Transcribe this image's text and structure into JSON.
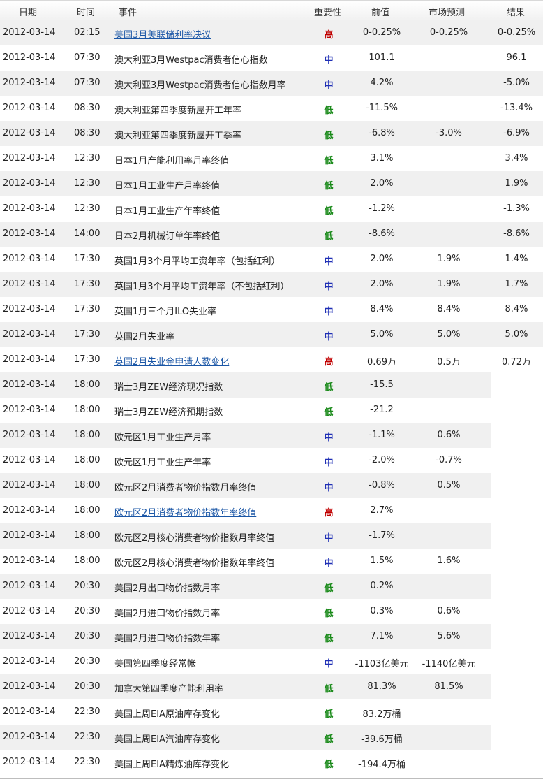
{
  "header": {
    "date": "日期",
    "time": "时间",
    "event": "事件",
    "importance": "重要性",
    "previous": "前值",
    "forecast": "市场预测",
    "actual": "结果"
  },
  "colors": {
    "high": "#c00000",
    "medium": "#1f2fb5",
    "low": "#1a8a1a",
    "link": "#1a56a6",
    "stripe": "#f0f0f0"
  },
  "rows": [
    {
      "date": "2012-03-14",
      "time": "02:15",
      "event": "美国3月美联储利率决议",
      "link": true,
      "importance": "高",
      "level": "high",
      "previous": "0-0.25%",
      "forecast": "0-0.25%",
      "actual": "0-0.25%"
    },
    {
      "date": "2012-03-14",
      "time": "07:30",
      "event": "澳大利亚3月Westpac消费者信心指数",
      "link": false,
      "importance": "中",
      "level": "medium",
      "previous": "101.1",
      "forecast": "",
      "actual": "96.1"
    },
    {
      "date": "2012-03-14",
      "time": "07:30",
      "event": "澳大利亚3月Westpac消费者信心指数月率",
      "link": false,
      "importance": "中",
      "level": "medium",
      "previous": "4.2%",
      "forecast": "",
      "actual": "-5.0%"
    },
    {
      "date": "2012-03-14",
      "time": "08:30",
      "event": "澳大利亚第四季度新屋开工年率",
      "link": false,
      "importance": "低",
      "level": "low",
      "previous": "-11.5%",
      "forecast": "",
      "actual": "-13.4%"
    },
    {
      "date": "2012-03-14",
      "time": "08:30",
      "event": "澳大利亚第四季度新屋开工季率",
      "link": false,
      "importance": "低",
      "level": "low",
      "previous": "-6.8%",
      "forecast": "-3.0%",
      "actual": "-6.9%"
    },
    {
      "date": "2012-03-14",
      "time": "12:30",
      "event": "日本1月产能利用率月率终值",
      "link": false,
      "importance": "低",
      "level": "low",
      "previous": "3.1%",
      "forecast": "",
      "actual": "3.4%"
    },
    {
      "date": "2012-03-14",
      "time": "12:30",
      "event": "日本1月工业生产月率终值",
      "link": false,
      "importance": "低",
      "level": "low",
      "previous": "2.0%",
      "forecast": "",
      "actual": "1.9%"
    },
    {
      "date": "2012-03-14",
      "time": "12:30",
      "event": "日本1月工业生产年率终值",
      "link": false,
      "importance": "低",
      "level": "low",
      "previous": "-1.2%",
      "forecast": "",
      "actual": "-1.3%"
    },
    {
      "date": "2012-03-14",
      "time": "14:00",
      "event": "日本2月机械订单年率终值",
      "link": false,
      "importance": "低",
      "level": "low",
      "previous": "-8.6%",
      "forecast": "",
      "actual": "-8.6%"
    },
    {
      "date": "2012-03-14",
      "time": "17:30",
      "event": "英国1月3个月平均工资年率（包括红利）",
      "link": false,
      "importance": "中",
      "level": "medium",
      "previous": "2.0%",
      "forecast": "1.9%",
      "actual": "1.4%"
    },
    {
      "date": "2012-03-14",
      "time": "17:30",
      "event": "英国1月3个月平均工资年率（不包括红利）",
      "link": false,
      "importance": "中",
      "level": "medium",
      "previous": "2.0%",
      "forecast": "1.9%",
      "actual": "1.7%"
    },
    {
      "date": "2012-03-14",
      "time": "17:30",
      "event": "英国1月三个月ILO失业率",
      "link": false,
      "importance": "中",
      "level": "medium",
      "previous": "8.4%",
      "forecast": "8.4%",
      "actual": "8.4%"
    },
    {
      "date": "2012-03-14",
      "time": "17:30",
      "event": "英国2月失业率",
      "link": false,
      "importance": "中",
      "level": "medium",
      "previous": "5.0%",
      "forecast": "5.0%",
      "actual": "5.0%"
    },
    {
      "date": "2012-03-14",
      "time": "17:30",
      "event": "英国2月失业金申请人数变化",
      "link": true,
      "importance": "高",
      "level": "high",
      "previous": "0.69万",
      "forecast": "0.5万",
      "actual": "0.72万"
    },
    {
      "date": "2012-03-14",
      "time": "18:00",
      "event": "瑞士3月ZEW经济现况指数",
      "link": false,
      "importance": "低",
      "level": "low",
      "previous": "-15.5",
      "forecast": "",
      "actual": ""
    },
    {
      "date": "2012-03-14",
      "time": "18:00",
      "event": "瑞士3月ZEW经济预期指数",
      "link": false,
      "importance": "低",
      "level": "low",
      "previous": "-21.2",
      "forecast": "",
      "actual": ""
    },
    {
      "date": "2012-03-14",
      "time": "18:00",
      "event": "欧元区1月工业生产月率",
      "link": false,
      "importance": "中",
      "level": "medium",
      "previous": "-1.1%",
      "forecast": "0.6%",
      "actual": ""
    },
    {
      "date": "2012-03-14",
      "time": "18:00",
      "event": "欧元区1月工业生产年率",
      "link": false,
      "importance": "中",
      "level": "medium",
      "previous": "-2.0%",
      "forecast": "-0.7%",
      "actual": ""
    },
    {
      "date": "2012-03-14",
      "time": "18:00",
      "event": "欧元区2月消费者物价指数月率终值",
      "link": false,
      "importance": "中",
      "level": "medium",
      "previous": "-0.8%",
      "forecast": "0.5%",
      "actual": ""
    },
    {
      "date": "2012-03-14",
      "time": "18:00",
      "event": "欧元区2月消费者物价指数年率终值",
      "link": true,
      "importance": "高",
      "level": "high",
      "previous": "2.7%",
      "forecast": "",
      "actual": ""
    },
    {
      "date": "2012-03-14",
      "time": "18:00",
      "event": "欧元区2月核心消费者物价指数月率终值",
      "link": false,
      "importance": "中",
      "level": "medium",
      "previous": "-1.7%",
      "forecast": "",
      "actual": ""
    },
    {
      "date": "2012-03-14",
      "time": "18:00",
      "event": "欧元区2月核心消费者物价指数年率终值",
      "link": false,
      "importance": "中",
      "level": "medium",
      "previous": "1.5%",
      "forecast": "1.6%",
      "actual": ""
    },
    {
      "date": "2012-03-14",
      "time": "20:30",
      "event": "美国2月出口物价指数月率",
      "link": false,
      "importance": "低",
      "level": "low",
      "previous": "0.2%",
      "forecast": "",
      "actual": ""
    },
    {
      "date": "2012-03-14",
      "time": "20:30",
      "event": "美国2月进口物价指数月率",
      "link": false,
      "importance": "低",
      "level": "low",
      "previous": "0.3%",
      "forecast": "0.6%",
      "actual": ""
    },
    {
      "date": "2012-03-14",
      "time": "20:30",
      "event": "美国2月进口物价指数年率",
      "link": false,
      "importance": "低",
      "level": "low",
      "previous": "7.1%",
      "forecast": "5.6%",
      "actual": ""
    },
    {
      "date": "2012-03-14",
      "time": "20:30",
      "event": "美国第四季度经常帐",
      "link": false,
      "importance": "中",
      "level": "medium",
      "previous": "-1103亿美元",
      "forecast": "-1140亿美元",
      "actual": ""
    },
    {
      "date": "2012-03-14",
      "time": "20:30",
      "event": "加拿大第四季度产能利用率",
      "link": false,
      "importance": "低",
      "level": "low",
      "previous": "81.3%",
      "forecast": "81.5%",
      "actual": ""
    },
    {
      "date": "2012-03-14",
      "time": "22:30",
      "event": "美国上周EIA原油库存变化",
      "link": false,
      "importance": "低",
      "level": "low",
      "previous": "83.2万桶",
      "forecast": "",
      "actual": ""
    },
    {
      "date": "2012-03-14",
      "time": "22:30",
      "event": "美国上周EIA汽油库存变化",
      "link": false,
      "importance": "低",
      "level": "low",
      "previous": "-39.6万桶",
      "forecast": "",
      "actual": ""
    },
    {
      "date": "2012-03-14",
      "time": "22:30",
      "event": "美国上周EIA精炼油库存变化",
      "link": false,
      "importance": "低",
      "level": "low",
      "previous": "-194.4万桶",
      "forecast": "",
      "actual": ""
    }
  ]
}
